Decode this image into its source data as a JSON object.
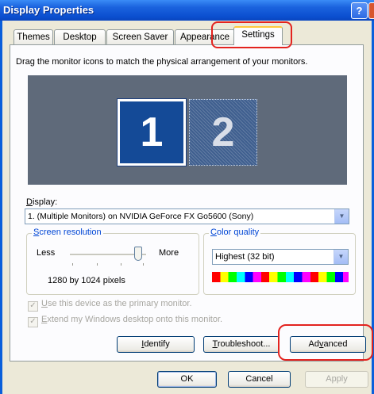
{
  "window": {
    "title": "Display Properties",
    "help_glyph": "?"
  },
  "tabs": [
    {
      "label": "Themes"
    },
    {
      "label": "Desktop"
    },
    {
      "label": "Screen Saver"
    },
    {
      "label": "Appearance"
    },
    {
      "label": "Settings",
      "active": true
    }
  ],
  "instruction": "Drag the monitor icons to match the physical arrangement of your monitors.",
  "monitors": [
    {
      "number": "1",
      "selected": true
    },
    {
      "number": "2",
      "selected": false
    }
  ],
  "display": {
    "label_accel": "D",
    "label_rest": "isplay:",
    "value": "1. (Multiple Monitors) on NVIDIA GeForce FX Go5600 (Sony)"
  },
  "resolution": {
    "title_accel": "S",
    "title_rest": "creen resolution",
    "less": "Less",
    "more": "More",
    "value_text": "1280 by 1024 pixels",
    "slider_fraction": 0.9
  },
  "color_quality": {
    "title_accel": "C",
    "title_rest": "olor quality",
    "value": "Highest (32 bit)"
  },
  "checkboxes": {
    "primary": {
      "accel": "U",
      "rest": "se this device as the primary monitor.",
      "checked": true,
      "enabled": false
    },
    "extend": {
      "accel": "E",
      "rest": "xtend my Windows desktop onto this monitor.",
      "checked": true,
      "enabled": false
    }
  },
  "buttons": {
    "identify": {
      "accel": "I",
      "rest": "dentify"
    },
    "troubleshoot": {
      "accel": "T",
      "rest": "roubleshoot..."
    },
    "advanced": {
      "pre": "Ad",
      "accel": "v",
      "post": "anced"
    },
    "ok": "OK",
    "cancel": "Cancel",
    "apply": "Apply"
  },
  "colors": {
    "title_bar": "#0b4fd0",
    "annotation_red": "#e3231f",
    "monitor_selected": "#144a97",
    "monitor_area": "#5f6a7a",
    "group_title": "#0046d5"
  }
}
